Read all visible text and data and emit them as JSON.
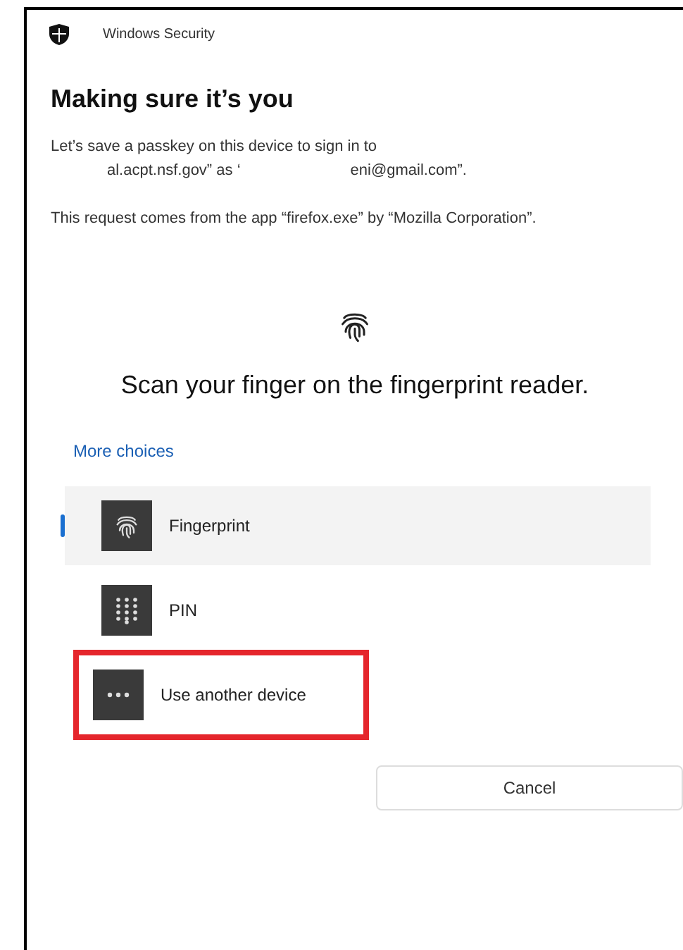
{
  "window": {
    "title": "Windows Security"
  },
  "heading": "Making sure it’s you",
  "message": {
    "line_1": "Let’s save a passkey on this device to sign in to",
    "line_2_parts": [
      "al.acpt.nsf.gov” as ‘",
      "eni@gmail.com”."
    ]
  },
  "request_note": "This request comes from the app “firefox.exe” by “Mozilla Corporation”.",
  "prompt": "Scan your finger on the fingerprint reader.",
  "more_choices": "More choices",
  "options": [
    {
      "kind": "fingerprint",
      "label": "Fingerprint",
      "selected": true,
      "highlighted": false
    },
    {
      "kind": "pin",
      "label": "PIN",
      "selected": false,
      "highlighted": false
    },
    {
      "kind": "more",
      "label": "Use another device",
      "selected": false,
      "highlighted": true
    }
  ],
  "buttons": [
    "Cancel"
  ]
}
